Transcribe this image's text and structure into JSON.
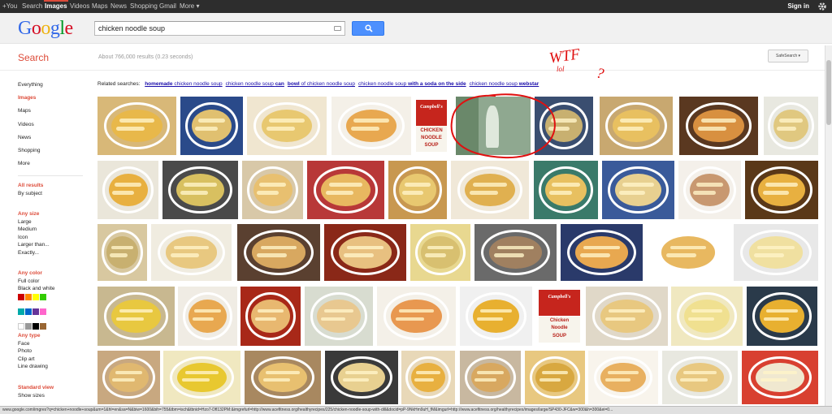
{
  "topbar": {
    "items": [
      {
        "label": "+You",
        "active": false
      },
      {
        "label": "Search",
        "active": false
      },
      {
        "label": "Images",
        "active": true
      },
      {
        "label": "Videos",
        "active": false
      },
      {
        "label": "Maps",
        "active": false
      },
      {
        "label": "News",
        "active": false
      },
      {
        "label": "Shopping",
        "active": false
      },
      {
        "label": "Gmail",
        "active": false
      },
      {
        "label": "More ▾",
        "active": false
      }
    ],
    "sign_in": "Sign in",
    "settings_icon": "gear-icon"
  },
  "header": {
    "logo": [
      "G",
      "o",
      "o",
      "g",
      "l",
      "e"
    ],
    "logo_colors": [
      "#3369e8",
      "#d50f25",
      "#eeb211",
      "#3369e8",
      "#009925",
      "#d50f25"
    ],
    "search_value": "chicken noodle soup",
    "search_button_icon": "search-icon"
  },
  "subbar": {
    "search_label": "Search",
    "results_stats": "About 766,000 results (0.23 seconds)",
    "safesearch": "SafeSearch ▾"
  },
  "sidebar": {
    "nav": [
      {
        "label": "Everything",
        "active": false
      },
      {
        "label": "Images",
        "active": true
      },
      {
        "label": "Maps",
        "active": false
      },
      {
        "label": "Videos",
        "active": false
      },
      {
        "label": "News",
        "active": false
      },
      {
        "label": "Shopping",
        "active": false
      },
      {
        "label": "More",
        "active": false
      }
    ],
    "results_title": "All results",
    "results_option": "By subject",
    "size_title": "Any size",
    "size_options": [
      "Large",
      "Medium",
      "Icon",
      "Larger than...",
      "Exactly..."
    ],
    "color_title": "Any color",
    "color_options": [
      "Full color",
      "Black and white"
    ],
    "swatches": [
      "#c00",
      "#f80",
      "#ff0",
      "#3c0",
      "#0aa",
      "#06c",
      "#639",
      "#f6c",
      "#fff",
      "#999",
      "#000",
      "#963"
    ],
    "type_title": "Any type",
    "type_options": [
      "Face",
      "Photo",
      "Clip art",
      "Line drawing"
    ],
    "view_title": "Standard view",
    "view_option": "Show sizes"
  },
  "related": {
    "prefix": "Related searches:",
    "links": [
      {
        "bold": "homemade",
        "rest": " chicken noodle soup"
      },
      {
        "bold": "",
        "rest": "chicken noodle soup ",
        "bold2": "can"
      },
      {
        "bold": "bowl",
        "rest": " of chicken noodle soup"
      },
      {
        "bold": "",
        "rest": "chicken noodle soup ",
        "bold2": "with a soda on the side"
      },
      {
        "bold": "",
        "rest": "chicken noodle soup ",
        "bold2": "webstar"
      }
    ]
  },
  "annotation": {
    "main": "WTF",
    "small": "lol",
    "mark": "?"
  },
  "can_labels": {
    "brand": "Campbell's",
    "line1": "CHICKEN",
    "line2": "NOODLE",
    "line3": "SOUP"
  },
  "can_labels_b": {
    "brand": "Campbell's",
    "line1": "Chicken",
    "line2": "Noodle",
    "line3": "SOUP"
  },
  "thumbnails": [
    {
      "row": 0,
      "kind": "soup",
      "bg": "#d8b878",
      "soup": "#e8b84a"
    },
    {
      "row": 0,
      "kind": "soup",
      "bg": "#2a4a8a",
      "soup": "#e0c070"
    },
    {
      "row": 0,
      "kind": "soup",
      "bg": "#f0e6d0",
      "soup": "#e8c870"
    },
    {
      "row": 0,
      "kind": "soup",
      "bg": "#f4f0e8",
      "soup": "#e8a850"
    },
    {
      "row": 0,
      "kind": "can",
      "bg": "#fff"
    },
    {
      "row": 0,
      "kind": "photo",
      "bg": "#8fa890",
      "soup": "#5a7a5a"
    },
    {
      "row": 0,
      "kind": "soup",
      "bg": "#3a4e70",
      "soup": "#c8b070"
    },
    {
      "row": 0,
      "kind": "soup",
      "bg": "#c8a870",
      "soup": "#e8c060"
    },
    {
      "row": 0,
      "kind": "soup",
      "bg": "#5a3820",
      "soup": "#d89040"
    },
    {
      "row": 0,
      "kind": "soup",
      "bg": "#e8e8e0",
      "soup": "#e0c880"
    },
    {
      "row": 1,
      "kind": "soup",
      "bg": "#eae6da",
      "soup": "#e8b040"
    },
    {
      "row": 1,
      "kind": "soup",
      "bg": "#4a4a4a",
      "soup": "#d8c060"
    },
    {
      "row": 1,
      "kind": "soup",
      "bg": "#d8c8a8",
      "soup": "#e8c070"
    },
    {
      "row": 1,
      "kind": "soup",
      "bg": "#b83838",
      "soup": "#e8b860"
    },
    {
      "row": 1,
      "kind": "soup",
      "bg": "#c89850",
      "soup": "#e8c870"
    },
    {
      "row": 1,
      "kind": "soup",
      "bg": "#f0e8d8",
      "soup": "#e0b050"
    },
    {
      "row": 1,
      "kind": "soup",
      "bg": "#3a7a6a",
      "soup": "#e8c060"
    },
    {
      "row": 1,
      "kind": "soup",
      "bg": "#3a5a9a",
      "soup": "#e8d090"
    },
    {
      "row": 1,
      "kind": "soup",
      "bg": "#f4f0ea",
      "soup": "#c89870"
    },
    {
      "row": 1,
      "kind": "soup",
      "bg": "#5a3818",
      "soup": "#e8b040"
    },
    {
      "row": 2,
      "kind": "soup",
      "bg": "#d8c8a0",
      "soup": "#c8b070"
    },
    {
      "row": 2,
      "kind": "soup",
      "bg": "#f0ece0",
      "soup": "#e8c880"
    },
    {
      "row": 2,
      "kind": "soup",
      "bg": "#5a4030",
      "soup": "#d8a860"
    },
    {
      "row": 2,
      "kind": "soup",
      "bg": "#8a2818",
      "soup": "#e8c080"
    },
    {
      "row": 2,
      "kind": "soup",
      "bg": "#e8d890",
      "soup": "#d8c070"
    },
    {
      "row": 2,
      "kind": "soup",
      "bg": "#6a6a6a",
      "soup": "#a08060"
    },
    {
      "row": 2,
      "kind": "soup",
      "bg": "#2a3a6a",
      "soup": "#e8a850"
    },
    {
      "row": 2,
      "kind": "soup",
      "bg": "#ffffff",
      "soup": "#e8b860"
    },
    {
      "row": 2,
      "kind": "soup",
      "bg": "#e8e8e8",
      "soup": "#f0e0a0"
    },
    {
      "row": 3,
      "kind": "soup",
      "bg": "#c8b890",
      "soup": "#e8c840"
    },
    {
      "row": 3,
      "kind": "soup",
      "bg": "#f0ece4",
      "soup": "#e8a850"
    },
    {
      "row": 3,
      "kind": "soup",
      "bg": "#a82818",
      "soup": "#e8b870"
    },
    {
      "row": 3,
      "kind": "soup",
      "bg": "#d8dcd0",
      "soup": "#e8c890"
    },
    {
      "row": 3,
      "kind": "soup",
      "bg": "#f4f0e8",
      "soup": "#e89850"
    },
    {
      "row": 3,
      "kind": "soup",
      "bg": "#f0f0f0",
      "soup": "#e8b030"
    },
    {
      "row": 3,
      "kind": "can2",
      "bg": "#fff"
    },
    {
      "row": 3,
      "kind": "soup",
      "bg": "#e0d8c8",
      "soup": "#e8c880"
    },
    {
      "row": 3,
      "kind": "soup",
      "bg": "#f0e8c0",
      "soup": "#f0e090"
    },
    {
      "row": 3,
      "kind": "soup",
      "bg": "#2a3a4a",
      "soup": "#e8b030"
    },
    {
      "row": 4,
      "kind": "soup",
      "bg": "#c8a880",
      "soup": "#e0b870"
    },
    {
      "row": 4,
      "kind": "soup",
      "bg": "#f0e8c0",
      "soup": "#e8c830"
    },
    {
      "row": 4,
      "kind": "soup",
      "bg": "#a88860",
      "soup": "#e8c070"
    },
    {
      "row": 4,
      "kind": "soup",
      "bg": "#3a3a3a",
      "soup": "#e8d090"
    },
    {
      "row": 4,
      "kind": "soup",
      "bg": "#e8d8b8",
      "soup": "#e8b040"
    },
    {
      "row": 4,
      "kind": "soup",
      "bg": "#c8b8a0",
      "soup": "#d8a860"
    },
    {
      "row": 4,
      "kind": "soup",
      "bg": "#e8c880",
      "soup": "#d8a840"
    },
    {
      "row": 4,
      "kind": "soup",
      "bg": "#f8f4ec",
      "soup": "#e8b060"
    },
    {
      "row": 4,
      "kind": "soup",
      "bg": "#e8e8e0",
      "soup": "#e8c880"
    },
    {
      "row": 4,
      "kind": "soup",
      "bg": "#d84030",
      "soup": "#f0e8d0"
    }
  ],
  "status_url": "www.google.com/imgres?q=chicken+noodle+soup&um=1&hl=en&sa=N&biw=1600&bih=755&tbm=isch&tbnid=Hzo7-Dfl132PM:&imgrefurl=http://www.acefitness.org/healthyrecipes/225/chicken-noodle-soup-with-dill&docid=pP-9NkHm9uH_fM&imgurl=http://www.acefitness.org/healthyrecipes/images/large/SP430-JFC&w=300&h=300&ei=0..."
}
